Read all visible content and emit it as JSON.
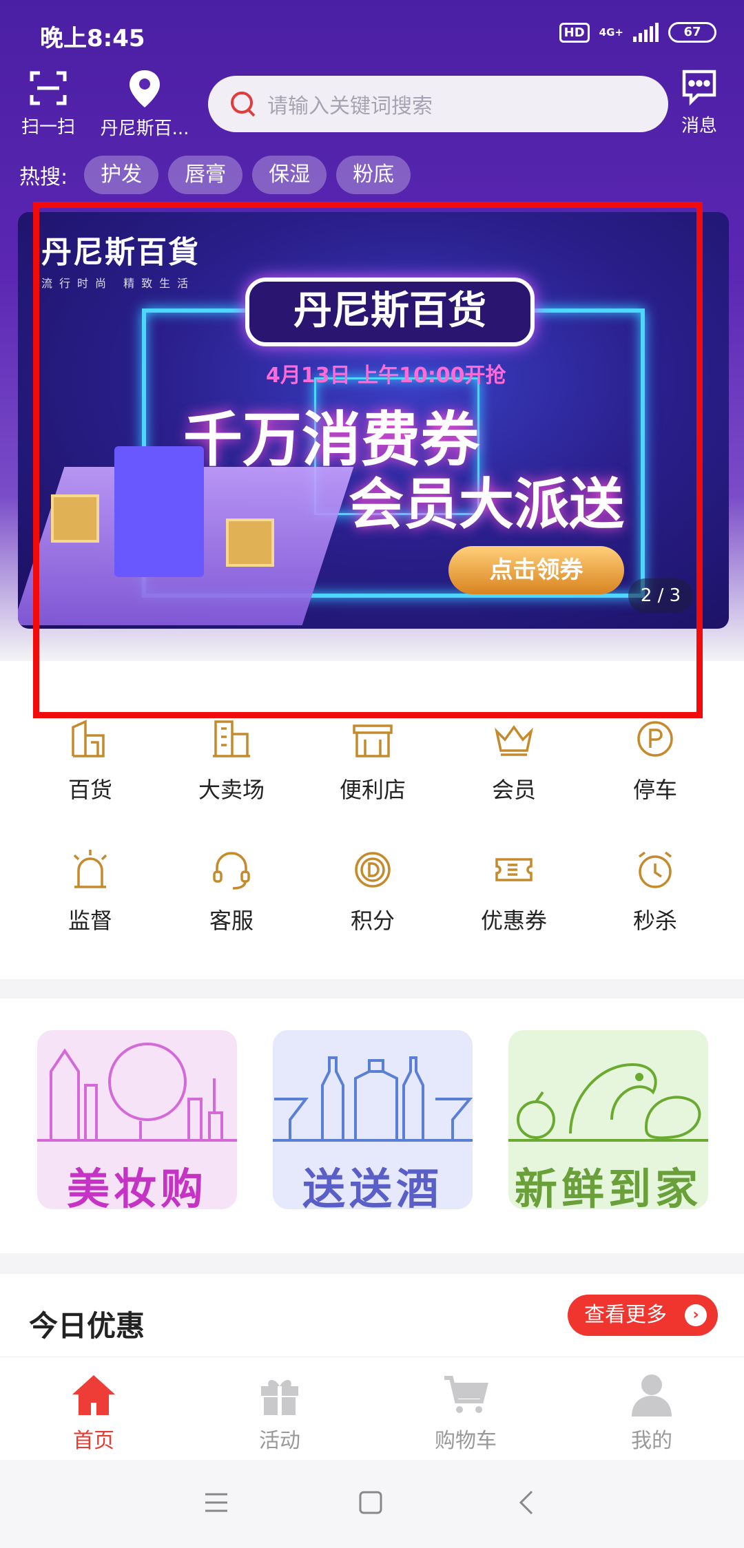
{
  "status_bar": {
    "time": "晚上8:45",
    "hd": "HD",
    "network": "4G+",
    "battery": "67"
  },
  "topbar": {
    "scan_label": "扫一扫",
    "location_label": "丹尼斯百...",
    "search_placeholder": "请输入关键词搜索",
    "message_label": "消息"
  },
  "hot_search": {
    "label": "热搜:",
    "chips": [
      "护发",
      "唇膏",
      "保湿",
      "粉底"
    ]
  },
  "banner": {
    "brand": "丹尼斯百貨",
    "brand_tagline": "流行时尚 精致生活",
    "title": "丹尼斯百货",
    "date": "4月13日 上午10:00开抢",
    "line1": "千万消费券",
    "line2": "会员大派送",
    "button": "点击领券",
    "page_indicator": "2 / 3"
  },
  "categories": [
    {
      "label": "百货",
      "icon": "department-store-icon"
    },
    {
      "label": "大卖场",
      "icon": "hypermarket-icon"
    },
    {
      "label": "便利店",
      "icon": "convenience-store-icon"
    },
    {
      "label": "会员",
      "icon": "crown-icon"
    },
    {
      "label": "停车",
      "icon": "parking-icon"
    },
    {
      "label": "监督",
      "icon": "alarm-light-icon"
    },
    {
      "label": "客服",
      "icon": "headset-icon"
    },
    {
      "label": "积分",
      "icon": "points-coin-icon"
    },
    {
      "label": "优惠券",
      "icon": "coupon-icon"
    },
    {
      "label": "秒杀",
      "icon": "alarm-clock-icon"
    }
  ],
  "promos": [
    {
      "label": "美妆购",
      "color": "#c533c4",
      "bg": "#f7e3f7"
    },
    {
      "label": "送送酒",
      "color": "#5a5fc8",
      "bg": "#e6e8fb"
    },
    {
      "label": "新鲜到家",
      "color": "#69a03a",
      "bg": "#e5f6dc"
    }
  ],
  "today": {
    "title": "今日优惠",
    "more": "查看更多"
  },
  "tabs": [
    {
      "label": "首页",
      "active": true
    },
    {
      "label": "活动",
      "active": false
    },
    {
      "label": "购物车",
      "active": false
    },
    {
      "label": "我的",
      "active": false
    }
  ],
  "colors": {
    "accent": "#e53b30",
    "header": "#4b1fa3",
    "icon_gold": "#c48a2c",
    "highlight_box": "#f20b0b"
  }
}
